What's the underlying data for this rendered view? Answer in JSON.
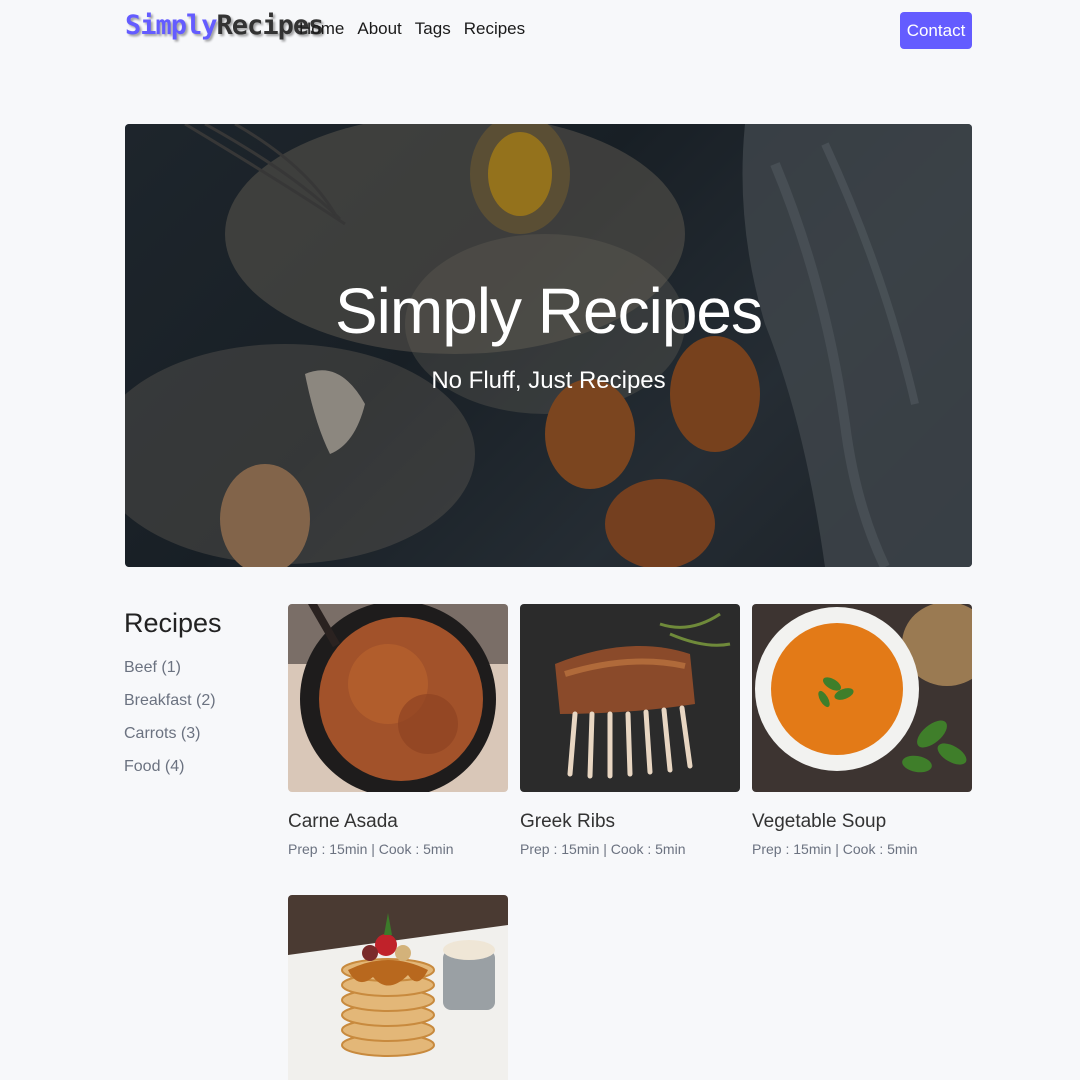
{
  "nav": {
    "logo_part1": "Simply",
    "logo_part2": "Recipes",
    "links": [
      "Home",
      "About",
      "Tags",
      "Recipes"
    ],
    "contact_label": "Contact"
  },
  "hero": {
    "title": "Simply Recipes",
    "subtitle": "No Fluff, Just Recipes"
  },
  "sidebar": {
    "title": "Recipes",
    "tags": [
      "Beef (1)",
      "Breakfast (2)",
      "Carrots (3)",
      "Food (4)"
    ]
  },
  "recipes": [
    {
      "title": "Carne Asada",
      "meta": "Prep : 15min | Cook : 5min"
    },
    {
      "title": "Greek Ribs",
      "meta": "Prep : 15min | Cook : 5min"
    },
    {
      "title": "Vegetable Soup",
      "meta": "Prep : 15min | Cook : 5min"
    },
    {
      "title": "",
      "meta": ""
    }
  ],
  "colors": {
    "accent": "#645cff",
    "background": "#f7f8fa",
    "muted_text": "#6b7280"
  }
}
